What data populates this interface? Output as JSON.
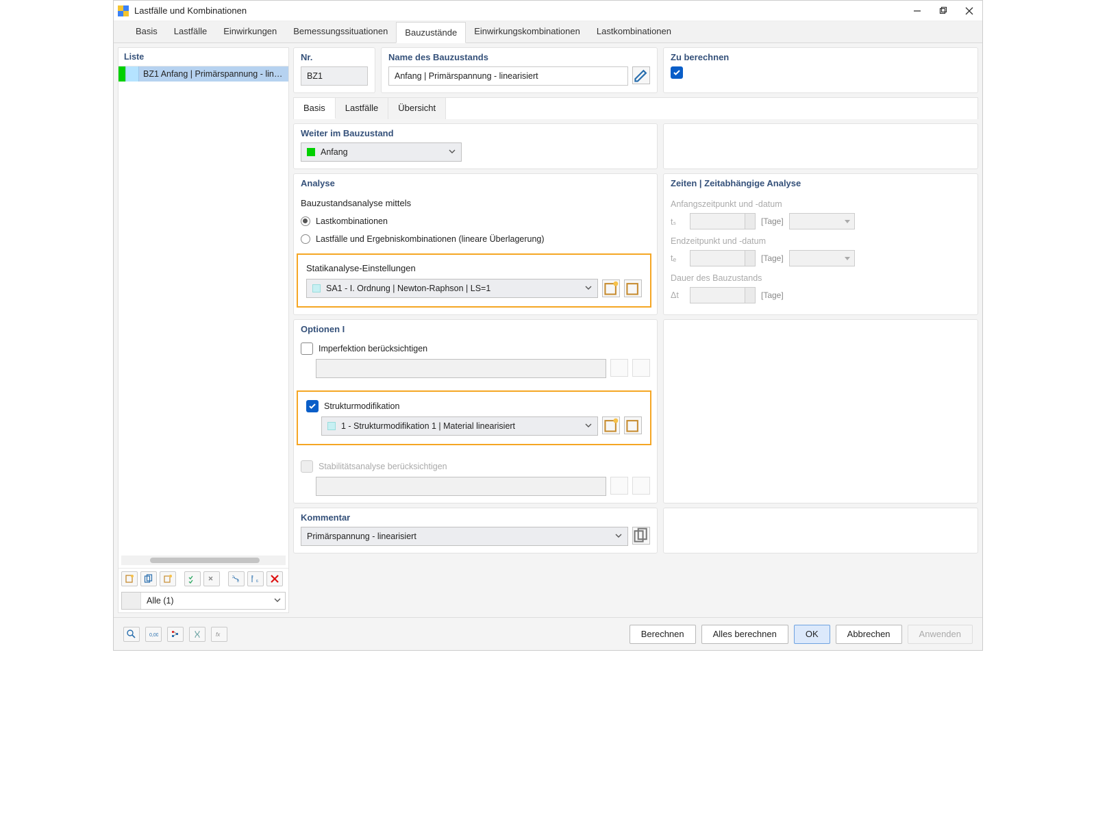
{
  "windowTitle": "Lastfälle und Kombinationen",
  "mainTabs": [
    "Basis",
    "Lastfälle",
    "Einwirkungen",
    "Bemessungssituationen",
    "Bauzustände",
    "Einwirkungskombinationen",
    "Lastkombinationen"
  ],
  "activeMainTab": 4,
  "leftPane": {
    "header": "Liste",
    "rowText": "BZ1  Anfang | Primärspannung - lin…",
    "filterText": "Alle (1)"
  },
  "headerFields": {
    "nrLabel": "Nr.",
    "nrValue": "BZ1",
    "nameLabel": "Name des Bauzustands",
    "nameValue": "Anfang | Primärspannung - linearisiert",
    "calcLabel": "Zu berechnen"
  },
  "subTabs": [
    "Basis",
    "Lastfälle",
    "Übersicht"
  ],
  "activeSubTab": 0,
  "continueSection": {
    "label": "Weiter im Bauzustand",
    "value": "Anfang"
  },
  "analysis": {
    "header": "Analyse",
    "byLabel": "Bauzustandsanalyse mittels",
    "opt1": "Lastkombinationen",
    "opt2": "Lastfälle und Ergebniskombinationen (lineare Überlagerung)",
    "staticLabel": "Statikanalyse-Einstellungen",
    "staticValue": "SA1 - I. Ordnung | Newton-Raphson | LS=1"
  },
  "times": {
    "header": "Zeiten | Zeitabhängige Analyse",
    "startLabel": "Anfangszeitpunkt und -datum",
    "ts": "tₛ",
    "endLabel": "Endzeitpunkt und -datum",
    "te": "tₑ",
    "durLabel": "Dauer des Bauzustands",
    "dt": "Δt",
    "unit": "[Tage]"
  },
  "options": {
    "header": "Optionen I",
    "imperf": "Imperfektion berücksichtigen",
    "structMod": "Strukturmodifikation",
    "structModValue": "1 - Strukturmodifikation 1 | Material linearisiert",
    "stab": "Stabilitätsanalyse berücksichtigen"
  },
  "comment": {
    "header": "Kommentar",
    "value": "Primärspannung - linearisiert"
  },
  "footer": {
    "calculate": "Berechnen",
    "calcAll": "Alles berechnen",
    "ok": "OK",
    "cancel": "Abbrechen",
    "apply": "Anwenden"
  }
}
